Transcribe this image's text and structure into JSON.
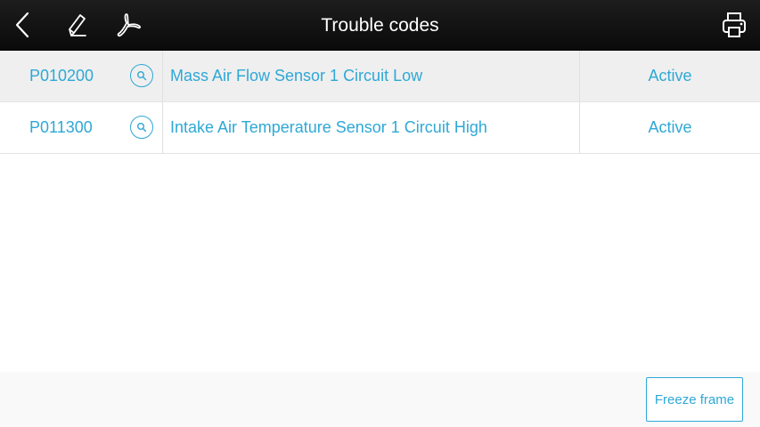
{
  "header": {
    "title": "Trouble codes",
    "icons": [
      "back-icon",
      "edit-icon",
      "pdf-icon",
      "print-icon"
    ]
  },
  "table": {
    "rows": [
      {
        "code": "P010200",
        "description": "Mass Air Flow Sensor 1 Circuit Low",
        "status": "Active",
        "selected": true
      },
      {
        "code": "P011300",
        "description": "Intake Air Temperature Sensor 1 Circuit High",
        "status": "Active",
        "selected": false
      }
    ]
  },
  "footer": {
    "freeze_frame_label": "Freeze frame"
  },
  "colors": {
    "accent": "#2ea8d6",
    "header_bg": "#111111",
    "selected_row_bg": "#efefef"
  }
}
